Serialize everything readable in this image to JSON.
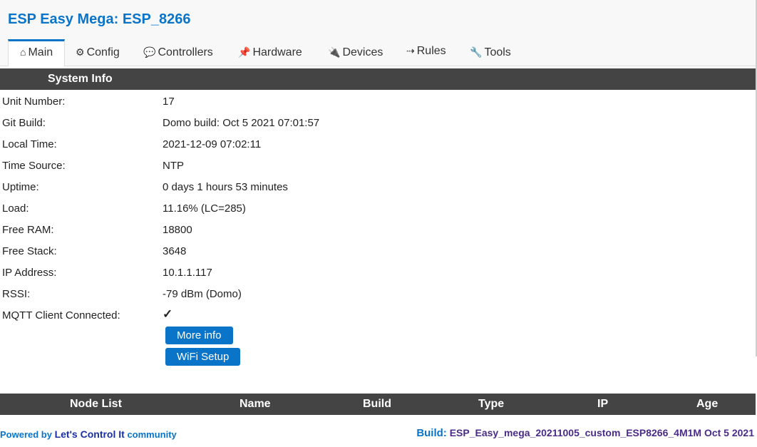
{
  "app": {
    "title": "ESP Easy Mega: ESP_8266"
  },
  "tabs": [
    {
      "icon": "⌂",
      "label": "Main"
    },
    {
      "icon": "⚙",
      "label": "Config"
    },
    {
      "icon": "💬",
      "label": "Controllers"
    },
    {
      "icon": "📌",
      "label": "Hardware"
    },
    {
      "icon": "🔌",
      "label": "Devices"
    },
    {
      "icon": "⇢",
      "label": "Rules"
    },
    {
      "icon": "🔧",
      "label": "Tools"
    }
  ],
  "system_info": {
    "header": "System Info",
    "rows": [
      {
        "label": "Unit Number:",
        "value": "17"
      },
      {
        "label": "Git Build:",
        "value": "Domo build: Oct 5 2021 07:01:57"
      },
      {
        "label": "Local Time:",
        "value": "2021-12-09 07:02:11"
      },
      {
        "label": "Time Source:",
        "value": "NTP"
      },
      {
        "label": "Uptime:",
        "value": "0 days 1 hours 53 minutes"
      },
      {
        "label": "Load:",
        "value": "11.16% (LC=285)"
      },
      {
        "label": "Free RAM:",
        "value": "18800"
      },
      {
        "label": "Free Stack:",
        "value": "3648"
      },
      {
        "label": "IP Address:",
        "value": "10.1.1.117"
      },
      {
        "label": "RSSI:",
        "value": "-79 dBm (Domo)"
      },
      {
        "label": "MQTT Client Connected:",
        "value": "✓"
      }
    ],
    "buttons": {
      "more_info": "More info",
      "wifi_setup": "WiFi Setup"
    }
  },
  "node_list": {
    "columns": [
      "Node List",
      "Name",
      "Build",
      "Type",
      "IP",
      "Age"
    ]
  },
  "footer": {
    "powered_prefix": "Powered by",
    "powered_name": "Let's Control It",
    "powered_suffix": "community",
    "build_label": "Build:",
    "build_value": "ESP_Easy_mega_20211005_custom_ESP8266_4M1M Oct 5 2021"
  },
  "colors": {
    "accent": "#0a74c8",
    "header_bar": "#444444",
    "check": "#1c8a1c"
  }
}
